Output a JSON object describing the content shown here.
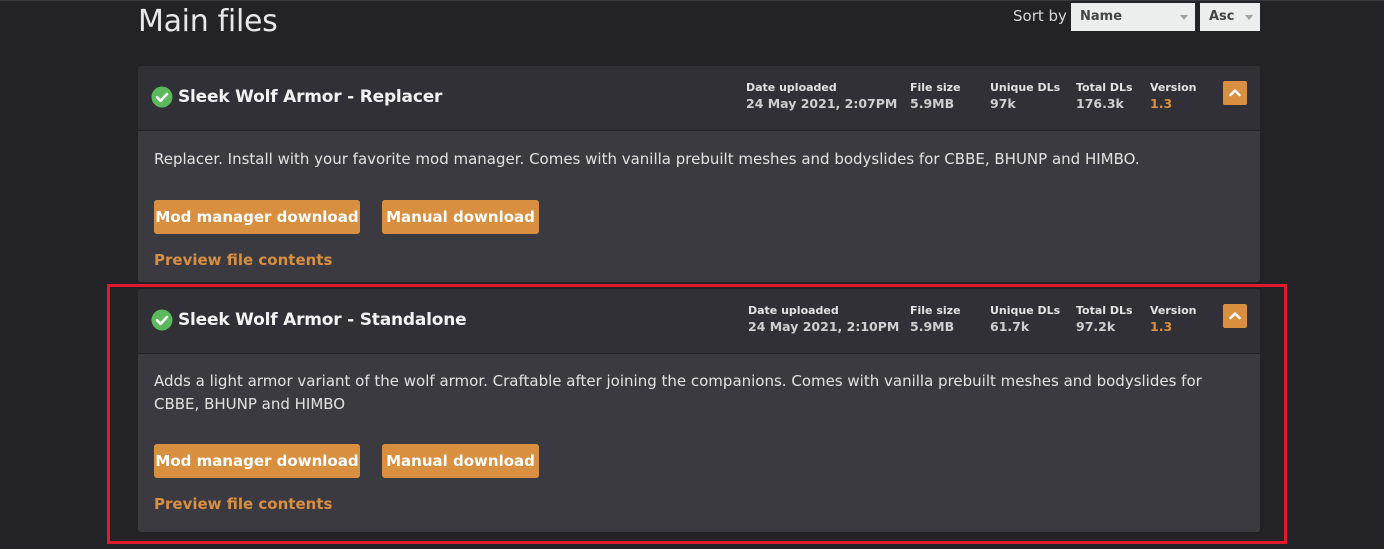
{
  "section": {
    "title": "Main files"
  },
  "sort": {
    "label": "Sort by",
    "field": "Name",
    "order": "Asc"
  },
  "colors": {
    "accent": "#d98f40",
    "card_bg": "#3b3a40",
    "header_bg": "#303036",
    "highlight": "#e0192c",
    "check": "#5cb85c"
  },
  "labels": {
    "date_uploaded": "Date uploaded",
    "file_size": "File size",
    "unique_dls": "Unique DLs",
    "total_dls": "Total DLs",
    "version": "Version"
  },
  "files": [
    {
      "name": "Sleek Wolf Armor - Replacer",
      "date_uploaded": "24 May 2021, 2:07PM",
      "file_size": "5.9MB",
      "unique_dls": "97k",
      "total_dls": "176.3k",
      "version": "1.3",
      "description": "Replacer. Install with your favorite mod manager. Comes with vanilla prebuilt meshes and bodyslides for CBBE, BHUNP and HIMBO.",
      "mod_manager_label": "Mod manager download",
      "manual_label": "Manual download",
      "preview_label": "Preview file contents"
    },
    {
      "name": "Sleek Wolf Armor - Standalone",
      "date_uploaded": "24 May 2021, 2:10PM",
      "file_size": "5.9MB",
      "unique_dls": "61.7k",
      "total_dls": "97.2k",
      "version": "1.3",
      "description": "Adds a light armor variant of the wolf armor. Craftable after joining the companions. Comes with vanilla prebuilt meshes and bodyslides for CBBE, BHUNP and HIMBO",
      "mod_manager_label": "Mod manager download",
      "manual_label": "Manual download",
      "preview_label": "Preview file contents"
    }
  ]
}
